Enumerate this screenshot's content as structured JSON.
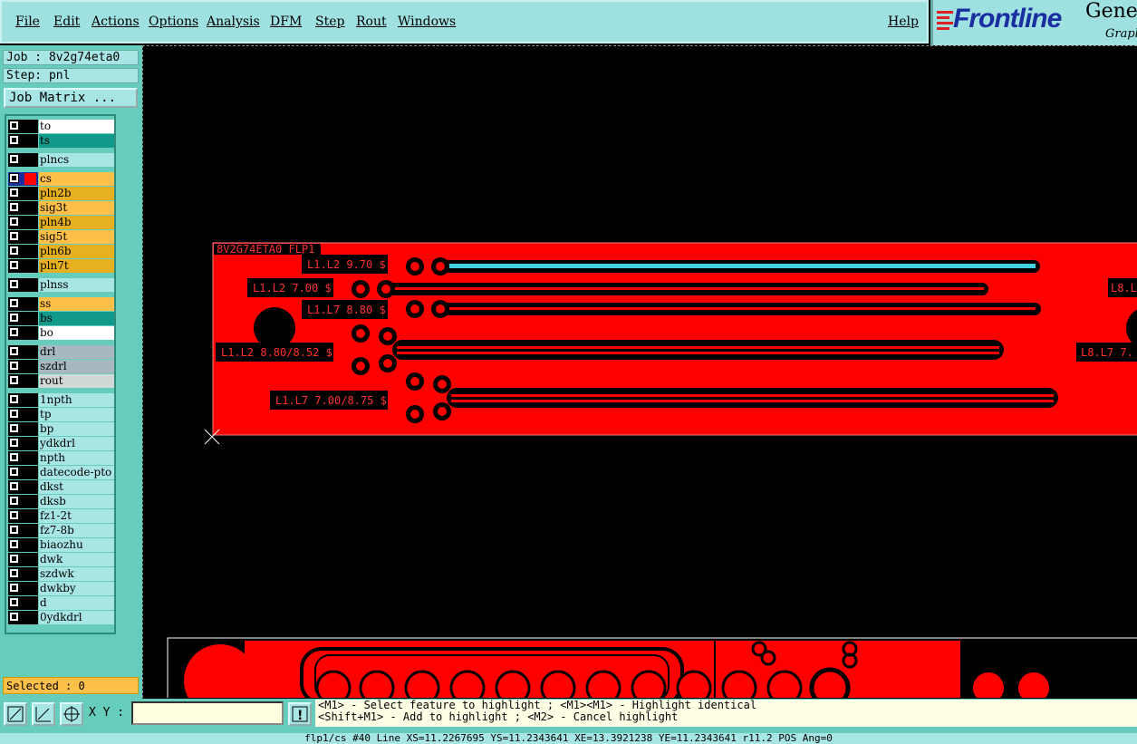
{
  "menu": [
    "File",
    "Edit",
    "Actions",
    "Options",
    "Analysis",
    "DFM",
    "Step",
    "Rout",
    "Windows"
  ],
  "help": "Help",
  "logo": {
    "brand": "Frontline",
    "product": "Genes",
    "sub": "Graph"
  },
  "job": "Job : 8v2g74eta0",
  "step": "Step: pnl",
  "job_matrix": "Job Matrix ...",
  "layers": [
    {
      "name": "to",
      "color": "#ffffff"
    },
    {
      "name": "ts",
      "color": "#11998a"
    },
    {
      "name": "plncs",
      "color": "#a8e6e6"
    },
    {
      "name": "cs",
      "color": "#ffc04a",
      "active": true
    },
    {
      "name": "pln2b",
      "color": "#e6b020"
    },
    {
      "name": "sig3t",
      "color": "#ffc04a"
    },
    {
      "name": "pln4b",
      "color": "#e6b020"
    },
    {
      "name": "sig5t",
      "color": "#ffc04a"
    },
    {
      "name": "pln6b",
      "color": "#e6b020"
    },
    {
      "name": "pln7t",
      "color": "#e6b020"
    },
    {
      "name": "plnss",
      "color": "#a8e6e6"
    },
    {
      "name": "ss",
      "color": "#ffc04a"
    },
    {
      "name": "bs",
      "color": "#11998a"
    },
    {
      "name": "bo",
      "color": "#ffffff"
    },
    {
      "name": "drl",
      "color": "#a8b8c0"
    },
    {
      "name": "szdrl",
      "color": "#a8b8c0"
    },
    {
      "name": "rout",
      "color": "#d0d8d8"
    },
    {
      "name": "1npth",
      "color": "#a8e6e6"
    },
    {
      "name": "tp",
      "color": "#a8e6e6"
    },
    {
      "name": "bp",
      "color": "#a8e6e6"
    },
    {
      "name": "ydkdrl",
      "color": "#a8e6e6"
    },
    {
      "name": "npth",
      "color": "#a8e6e6"
    },
    {
      "name": "datecode-pto",
      "color": "#a8e6e6"
    },
    {
      "name": "dkst",
      "color": "#a8e6e6"
    },
    {
      "name": "dksb",
      "color": "#a8e6e6"
    },
    {
      "name": "fz1-2t",
      "color": "#a8e6e6"
    },
    {
      "name": "fz7-8b",
      "color": "#a8e6e6"
    },
    {
      "name": "biaozhu",
      "color": "#a8e6e6"
    },
    {
      "name": "dwk",
      "color": "#a8e6e6"
    },
    {
      "name": "szdwk",
      "color": "#a8e6e6"
    },
    {
      "name": "dwkby",
      "color": "#a8e6e6"
    },
    {
      "name": "d",
      "color": "#a8e6e6"
    },
    {
      "name": "0ydkdrl",
      "color": "#a8e6e6"
    }
  ],
  "selected": "Selected : 0",
  "xy_label": "X Y :",
  "hint_line1": "<M1> - Select feature to highlight ; <M1><M1> - Highlight identical",
  "hint_line2": "<Shift+M1> - Add to highlight ; <M2> - Cancel highlight",
  "status": "flp1/cs #40 Line XS=11.2267695 YS=11.2343641 XE=13.3921238 YE=11.2343641 r11.2 POS Ang=0",
  "pcb": {
    "title": "8V2G74ETA0 FLP1",
    "labels": [
      "L1.L2 9.70 $",
      "L1.L2 7.00 $",
      "L1.L7 8.80 $",
      "L1.L2 8.80/8.52 $",
      "L1.L7 7.00/8.75 $",
      "L8.L",
      "L8.L7 7."
    ]
  }
}
